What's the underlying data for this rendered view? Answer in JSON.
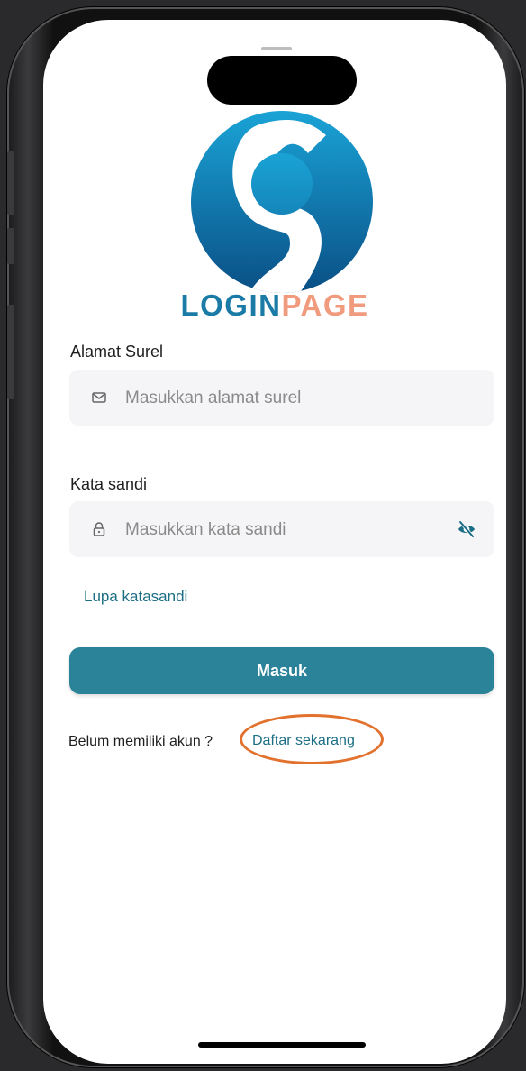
{
  "logo": {
    "text_part1": "LOGIN",
    "text_part2": "PAGE",
    "primary_color": "#1a7ba6",
    "accent_color": "#f09b7e"
  },
  "email": {
    "label": "Alamat Surel",
    "placeholder": "Masukkan alamat surel",
    "value": ""
  },
  "password": {
    "label": "Kata sandi",
    "placeholder": "Masukkan kata sandi",
    "value": ""
  },
  "forgot_password_label": "Lupa katasandi",
  "submit_label": "Masuk",
  "register": {
    "prompt": "Belum memiliki akun ?",
    "link_label": "Daftar sekarang"
  },
  "colors": {
    "button": "#2b8399",
    "link": "#1c6e84",
    "highlight": "#e2712e"
  }
}
